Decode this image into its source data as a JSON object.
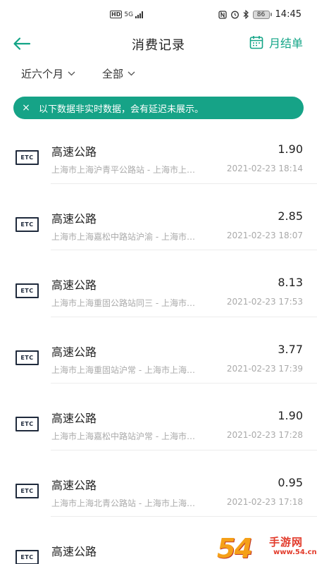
{
  "status_bar": {
    "network_badge": "HD",
    "network_type": "5G",
    "battery": "86",
    "time": "14:45"
  },
  "nav": {
    "title": "消费记录",
    "monthly_label": "月结单"
  },
  "filters": {
    "period": "近六个月",
    "category": "全部"
  },
  "notice": {
    "close_symbol": "×",
    "text": "以下数据非实时数据，会有延迟未展示。"
  },
  "etc_label": "ETC",
  "records": [
    {
      "title": "高速公路",
      "amount": "1.90",
      "location": "上海市上海沪青平公路站 - 上海市上…",
      "time": "2021-02-23 18:14"
    },
    {
      "title": "高速公路",
      "amount": "2.85",
      "location": "上海市上海嘉松中路站沪渝 - 上海市…",
      "time": "2021-02-23 18:07"
    },
    {
      "title": "高速公路",
      "amount": "8.13",
      "location": "上海市上海重固公路站同三 - 上海市…",
      "time": "2021-02-23 17:53"
    },
    {
      "title": "高速公路",
      "amount": "3.77",
      "location": "上海市上海重固站沪常 - 上海市上海…",
      "time": "2021-02-23 17:39"
    },
    {
      "title": "高速公路",
      "amount": "1.90",
      "location": "上海市上海嘉松中路站沪常 - 上海市…",
      "time": "2021-02-23 17:28"
    },
    {
      "title": "高速公路",
      "amount": "0.95",
      "location": "上海市上海北青公路站 - 上海市上海…",
      "time": "2021-02-23 17:18"
    },
    {
      "title": "高速公路",
      "amount": "",
      "location": "",
      "time": ""
    }
  ],
  "watermark": {
    "big": "54",
    "cn": "手游网",
    "url": "www.54.cn"
  },
  "colors": {
    "accent": "#16a387",
    "text_primary": "#222222",
    "text_secondary": "#aaaaaa"
  }
}
